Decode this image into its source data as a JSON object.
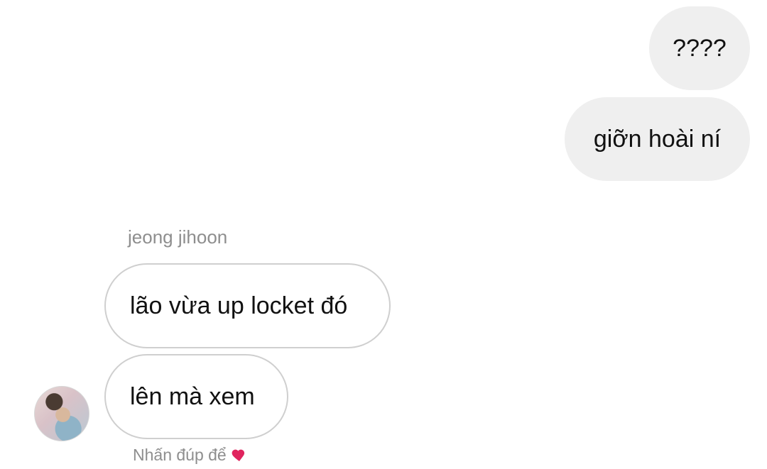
{
  "conversation": {
    "outgoing_messages": [
      {
        "text": "????"
      },
      {
        "text": "giỡn hoài ní"
      }
    ],
    "incoming_sender": "jeong jihoon",
    "incoming_messages": [
      {
        "text": "lão vừa up locket đó"
      },
      {
        "text": "lên mà xem"
      }
    ],
    "double_tap_hint": "Nhấn đúp để"
  },
  "icons": {
    "hint_icon": "heart-icon",
    "avatar_icon": "profile-avatar"
  },
  "colors": {
    "outgoing_bubble": "#efefef",
    "incoming_border": "#cfcfcf",
    "secondary_text": "#8e8e8e",
    "heart": "#e0245e"
  }
}
